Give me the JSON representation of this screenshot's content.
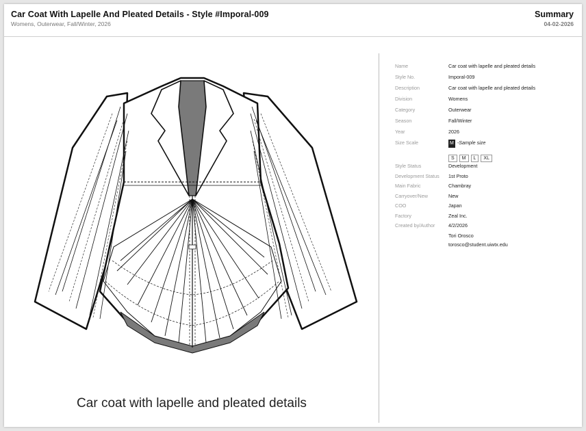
{
  "header": {
    "title": "Car Coat With Lapelle And Pleated Details - Style #Imporal-009",
    "subtitle": "Womens, Outerwear, Fall/Winter, 2026",
    "summary": "Summary",
    "date": "04-02-2026"
  },
  "caption": "Car coat with lapelle and pleated details",
  "specs": [
    {
      "label": "Name",
      "value": "Car coat with lapelle and pleated details"
    },
    {
      "label": "Style No.",
      "value": "Imporal-009"
    },
    {
      "label": "Description",
      "value": "Car coat with lapelle and pleated details"
    },
    {
      "label": "Division",
      "value": "Womens"
    },
    {
      "label": "Category",
      "value": "Outerwear"
    },
    {
      "label": "Season",
      "value": "Fall/Winter"
    },
    {
      "label": "Year",
      "value": "2026"
    }
  ],
  "size_scale": {
    "label": "Size Scale",
    "sample_size": "M",
    "sample_note": "-Sample size",
    "sizes": [
      "S",
      "M",
      "L",
      "XL"
    ]
  },
  "specs2": [
    {
      "label": "Style Status",
      "value": "Development"
    },
    {
      "label": "Development Status",
      "value": "1st Proto"
    },
    {
      "label": "Main Fabric",
      "value": "Chambray"
    },
    {
      "label": "Carryover/New",
      "value": "New"
    },
    {
      "label": "COO",
      "value": "Japan"
    },
    {
      "label": "Factory",
      "value": "Zeal Inc."
    },
    {
      "label": "Created by/Author",
      "value": "4/2/2026"
    }
  ],
  "author": {
    "name": "Tori Orosco",
    "email": "torosco@student.uiwtx.edu"
  }
}
